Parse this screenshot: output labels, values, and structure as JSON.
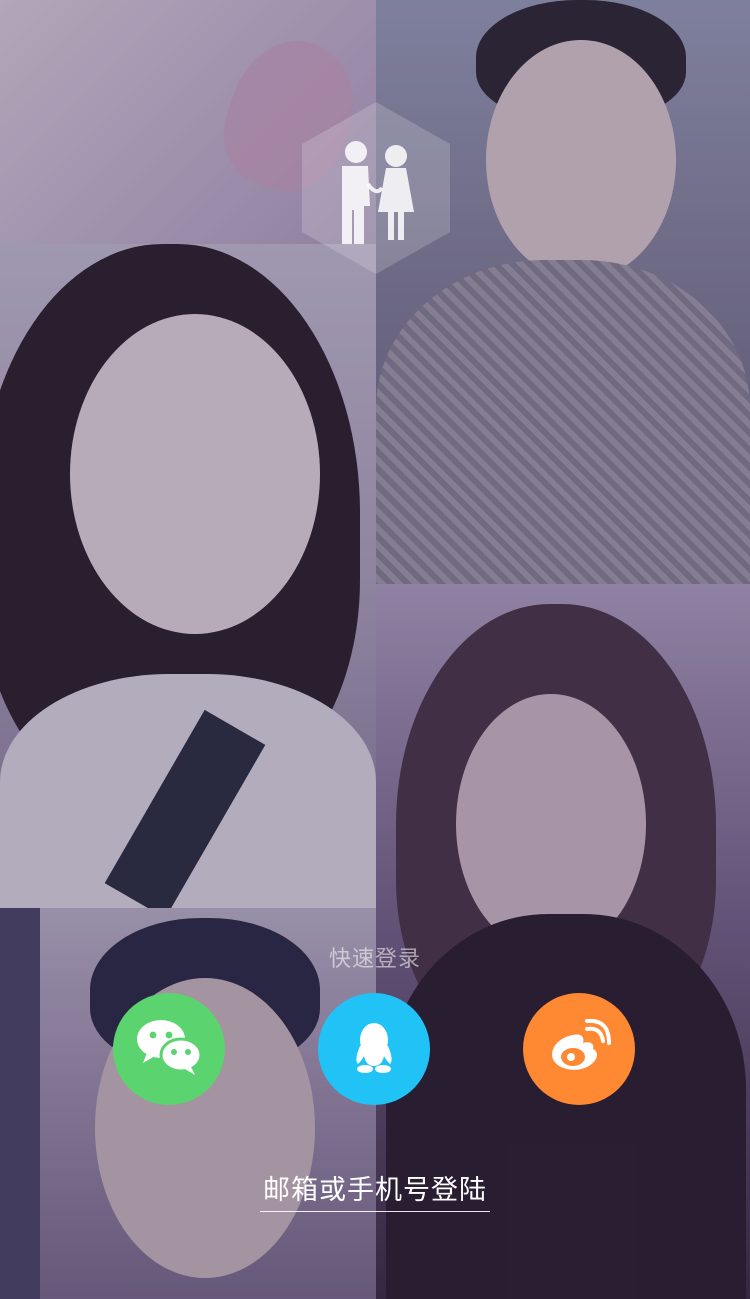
{
  "login": {
    "quick_login_label": "快速登录",
    "email_phone_login": "邮箱或手机号登陆"
  },
  "social": {
    "wechat": {
      "icon": "wechat-icon",
      "color": "#5bd36f"
    },
    "qq": {
      "icon": "qq-icon",
      "color": "#21c3f7"
    },
    "weibo": {
      "icon": "weibo-icon",
      "color": "#ff8833"
    }
  },
  "background": {
    "tiles": [
      "photo-tile-top-left",
      "photo-tile-top-right",
      "photo-tile-middle-left",
      "photo-tile-bottom-right",
      "photo-tile-bottom-left"
    ]
  },
  "logo": {
    "icon": "couple-logo-icon"
  }
}
